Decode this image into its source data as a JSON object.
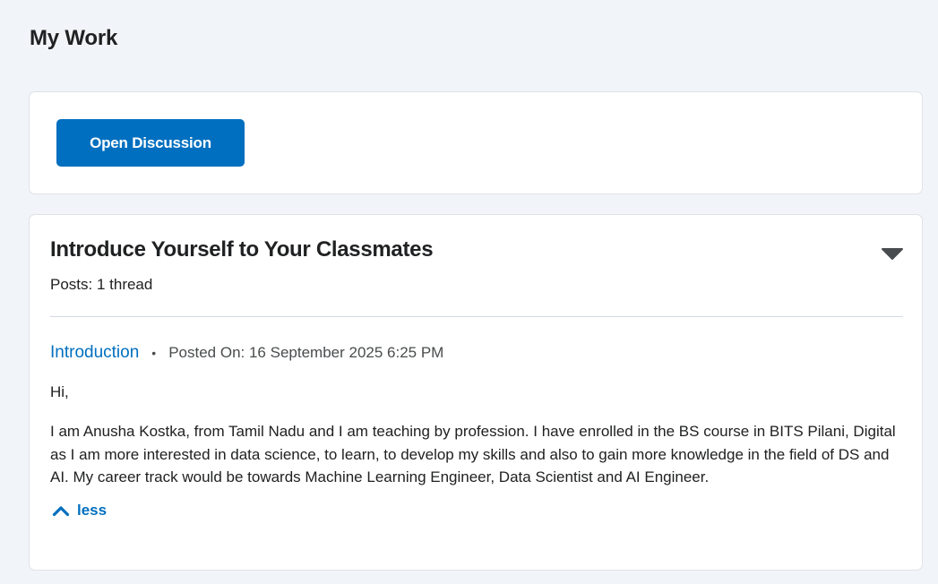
{
  "page": {
    "title": "My Work"
  },
  "actions": {
    "open_discussion_label": "Open Discussion"
  },
  "topic": {
    "title": "Introduce Yourself to Your Classmates",
    "posts_count": "Posts: 1 thread",
    "toggle_icon": "caret-down-icon"
  },
  "post": {
    "title_link": "Introduction",
    "separator": "•",
    "posted_on": "Posted On: 16 September 2025 6:25 PM",
    "greeting": "Hi,",
    "body": "I am Anusha Kostka, from Tamil Nadu and I am teaching by profession. I have enrolled in the BS course in BITS Pilani, Digital as I am more interested in data science, to learn, to develop my skills and also to gain more knowledge in the field of DS and AI. My career track would be towards Machine Learning Engineer, Data Scientist and AI Engineer.",
    "less_label": "less",
    "less_icon": "chevron-up-icon"
  },
  "colors": {
    "background": "#f1f4f8",
    "primary": "#006fbf",
    "text": "#202122",
    "muted": "#494c4e"
  }
}
